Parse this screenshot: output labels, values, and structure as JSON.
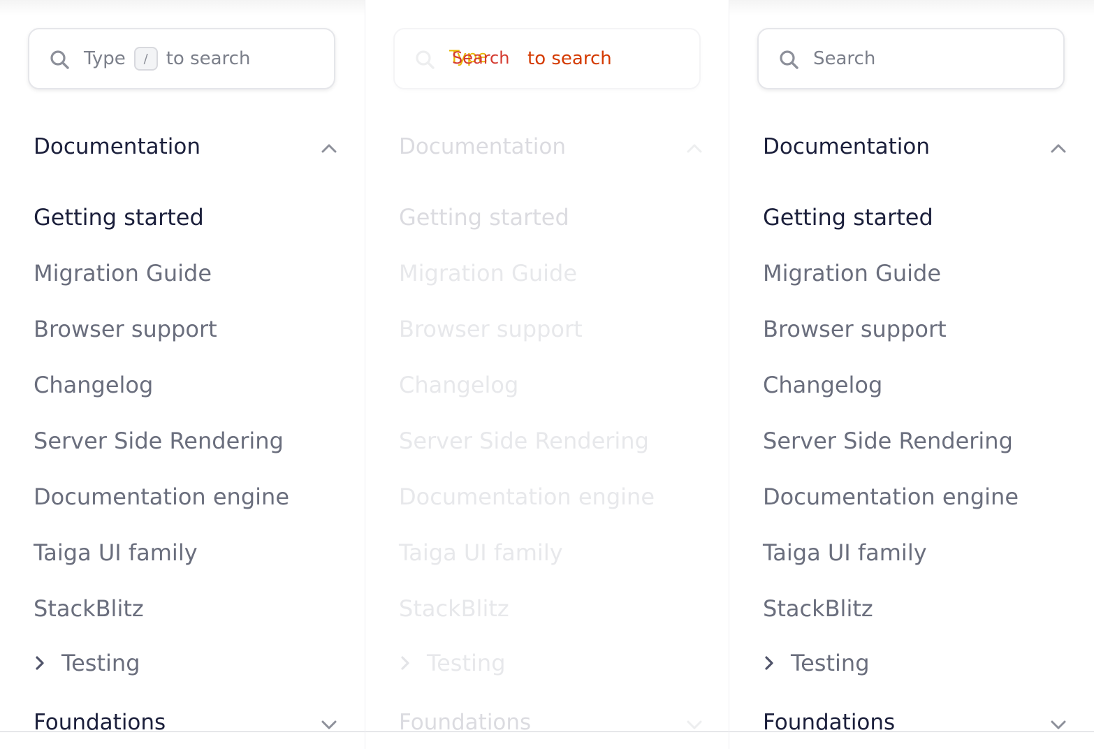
{
  "panels": {
    "a": {
      "search": {
        "prefix": "Type",
        "key": "/",
        "suffix": "to search"
      },
      "section_documentation": "Documentation",
      "items": [
        "Getting started",
        "Migration Guide",
        "Browser support",
        "Changelog",
        "Server Side Rendering",
        "Documentation engine",
        "Taiga UI family",
        "StackBlitz"
      ],
      "testing": "Testing",
      "section_foundations": "Foundations"
    },
    "b": {
      "search": {
        "glitch_a": "Type",
        "glitch_b": "Search",
        "suffix": "to search"
      },
      "section_documentation": "Documentation",
      "items": [
        "Getting started",
        "Migration Guide",
        "Browser support",
        "Changelog",
        "Server Side Rendering",
        "Documentation engine",
        "Taiga UI family",
        "StackBlitz"
      ],
      "testing": "Testing",
      "section_foundations": "Foundations"
    },
    "c": {
      "search": {
        "placeholder": "Search"
      },
      "section_documentation": "Documentation",
      "items": [
        "Getting started",
        "Migration Guide",
        "Browser support",
        "Changelog",
        "Server Side Rendering",
        "Documentation engine",
        "Taiga UI family",
        "StackBlitz"
      ],
      "testing": "Testing",
      "section_foundations": "Foundations"
    }
  },
  "colors": {
    "text_primary": "#1b1f3b",
    "text_secondary": "#6a6e7d",
    "border": "#e5e6ea",
    "glitch_yellow": "#e8b800",
    "glitch_red": "#d43a00"
  },
  "icons": {
    "search": "search-icon",
    "expanded": "chevron-up-icon",
    "collapsed": "chevron-down-icon",
    "subgroup": "chevron-right-icon"
  }
}
